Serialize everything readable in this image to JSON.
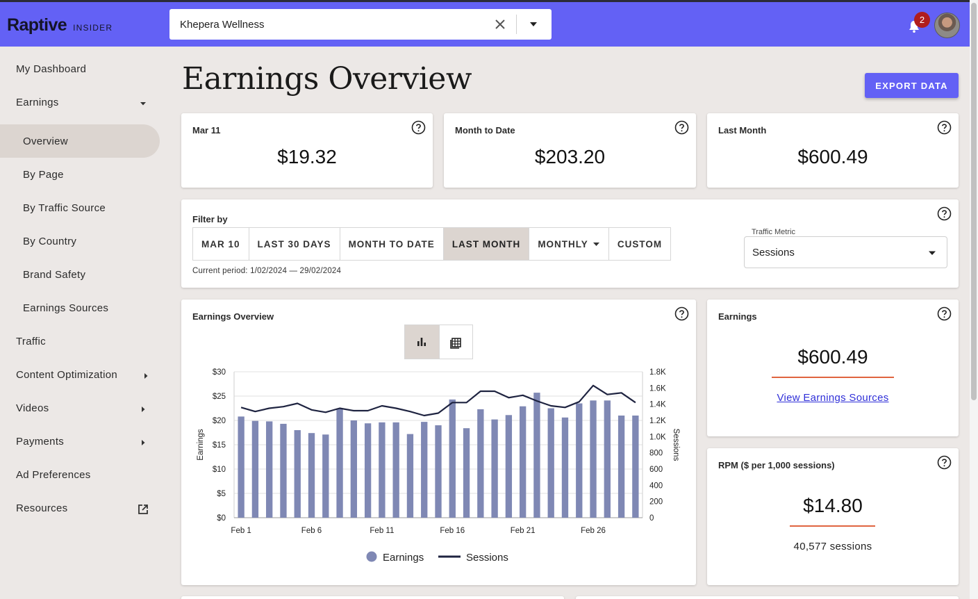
{
  "brand": {
    "name": "Raptive",
    "sub": "INSIDER"
  },
  "site_selector": {
    "value": "Khepera Wellness"
  },
  "notifications": {
    "count": "2"
  },
  "sidebar": {
    "items": [
      {
        "label": "My Dashboard"
      },
      {
        "label": "Earnings"
      },
      {
        "label": "Overview"
      },
      {
        "label": "By Page"
      },
      {
        "label": "By Traffic Source"
      },
      {
        "label": "By Country"
      },
      {
        "label": "Brand Safety"
      },
      {
        "label": "Earnings Sources"
      },
      {
        "label": "Traffic"
      },
      {
        "label": "Content Optimization"
      },
      {
        "label": "Videos"
      },
      {
        "label": "Payments"
      },
      {
        "label": "Ad Preferences"
      },
      {
        "label": "Resources"
      }
    ]
  },
  "page": {
    "title": "Earnings Overview",
    "export_label": "EXPORT DATA"
  },
  "stats": [
    {
      "label": "Mar 11",
      "value": "$19.32"
    },
    {
      "label": "Month to Date",
      "value": "$203.20"
    },
    {
      "label": "Last Month",
      "value": "$600.49"
    }
  ],
  "filter": {
    "label": "Filter by",
    "buttons": [
      {
        "label": "MAR 10"
      },
      {
        "label": "LAST 30 DAYS"
      },
      {
        "label": "MONTH TO DATE"
      },
      {
        "label": "LAST MONTH"
      },
      {
        "label": "MONTHLY"
      },
      {
        "label": "CUSTOM"
      }
    ],
    "period": "Current period: 1/02/2024 — 29/02/2024",
    "metric_label": "Traffic Metric",
    "metric_value": "Sessions"
  },
  "chart_card": {
    "title": "Earnings Overview"
  },
  "earnings_card": {
    "label": "Earnings",
    "value": "$600.49",
    "link": "View Earnings Sources"
  },
  "rpm_card": {
    "label": "RPM ($ per 1,000 sessions)",
    "value": "$14.80",
    "sessions": "40,577 sessions"
  },
  "colors": {
    "accent": "#6361f5",
    "bar": "#7f88b4",
    "line": "#1e2340",
    "underline": "#e0643f"
  },
  "chart_data": {
    "type": "bar",
    "x": [
      "Feb 1",
      "Feb 2",
      "Feb 3",
      "Feb 4",
      "Feb 5",
      "Feb 6",
      "Feb 7",
      "Feb 8",
      "Feb 9",
      "Feb 10",
      "Feb 11",
      "Feb 12",
      "Feb 13",
      "Feb 14",
      "Feb 15",
      "Feb 16",
      "Feb 17",
      "Feb 18",
      "Feb 19",
      "Feb 20",
      "Feb 21",
      "Feb 22",
      "Feb 23",
      "Feb 24",
      "Feb 25",
      "Feb 26",
      "Feb 27",
      "Feb 28",
      "Feb 29"
    ],
    "x_tick_labels": [
      "Feb 1",
      "Feb 6",
      "Feb 11",
      "Feb 16",
      "Feb 21",
      "Feb 26"
    ],
    "series": [
      {
        "name": "Earnings",
        "type": "bar",
        "axis": "left",
        "values": [
          20.8,
          19.9,
          19.8,
          19.3,
          18.0,
          17.4,
          17.1,
          22.5,
          20.0,
          19.4,
          19.6,
          19.6,
          17.2,
          19.7,
          19.0,
          24.3,
          18.4,
          22.3,
          20.2,
          21.1,
          22.9,
          25.7,
          22.5,
          20.6,
          23.5,
          24.1,
          24.1,
          21.0,
          21.0
        ]
      },
      {
        "name": "Sessions",
        "type": "line",
        "axis": "right",
        "values": [
          1360,
          1310,
          1350,
          1370,
          1410,
          1330,
          1300,
          1350,
          1320,
          1320,
          1380,
          1350,
          1310,
          1260,
          1290,
          1420,
          1420,
          1560,
          1560,
          1480,
          1510,
          1440,
          1380,
          1360,
          1430,
          1630,
          1520,
          1540,
          1420
        ]
      }
    ],
    "ylabel": "Earnings",
    "y2label": "Sessions",
    "ylim": [
      0,
      30
    ],
    "y_ticks": [
      "$0",
      "$5",
      "$10",
      "$15",
      "$20",
      "$25",
      "$30"
    ],
    "y2lim": [
      0,
      1800
    ],
    "y2_ticks": [
      "0",
      "200",
      "400",
      "600",
      "800",
      "1.0K",
      "1.2K",
      "1.4K",
      "1.6K",
      "1.8K"
    ],
    "grid": true,
    "legend": "bottom"
  }
}
